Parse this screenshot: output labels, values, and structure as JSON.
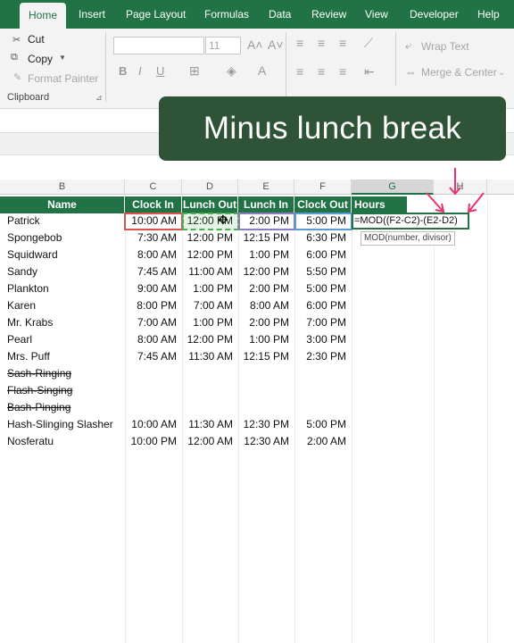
{
  "ribbon_tabs": [
    "Home",
    "Insert",
    "Page Layout",
    "Formulas",
    "Data",
    "Review",
    "View",
    "Developer",
    "Help"
  ],
  "clipboard": {
    "cut": "Cut",
    "copy": "Copy",
    "format_painter": "Format Painter",
    "group_label": "Clipboard"
  },
  "font": {
    "size": "11",
    "bold": "B",
    "italic": "I",
    "underline": "U"
  },
  "alignment": {
    "wrap_text": "Wrap Text",
    "merge_center": "Merge & Center"
  },
  "banner": {
    "text": "Minus lunch break"
  },
  "column_letters": [
    "B",
    "C",
    "D",
    "E",
    "F",
    "G",
    "H"
  ],
  "headers": [
    "Name",
    "Clock In",
    "Lunch Out",
    "Lunch In",
    "Clock Out",
    "Hours Worked"
  ],
  "rows": [
    {
      "name": "Patrick",
      "clock_in": "10:00 AM",
      "lunch_out": "12:00 PM",
      "lunch_in": "2:00 PM",
      "clock_out": "5:00 PM",
      "strike": false
    },
    {
      "name": "Spongebob",
      "clock_in": "7:30 AM",
      "lunch_out": "12:00 PM",
      "lunch_in": "12:15 PM",
      "clock_out": "6:30 PM",
      "strike": false
    },
    {
      "name": "Squidward",
      "clock_in": "8:00 AM",
      "lunch_out": "12:00 PM",
      "lunch_in": "1:00 PM",
      "clock_out": "6:00 PM",
      "strike": false
    },
    {
      "name": "Sandy",
      "clock_in": "7:45 AM",
      "lunch_out": "11:00 AM",
      "lunch_in": "12:00 PM",
      "clock_out": "5:50 PM",
      "strike": false
    },
    {
      "name": "Plankton",
      "clock_in": "9:00 AM",
      "lunch_out": "1:00 PM",
      "lunch_in": "2:00 PM",
      "clock_out": "5:00 PM",
      "strike": false
    },
    {
      "name": "Karen",
      "clock_in": "8:00 PM",
      "lunch_out": "7:00 AM",
      "lunch_in": "8:00 AM",
      "clock_out": "6:00 PM",
      "strike": false
    },
    {
      "name": "Mr. Krabs",
      "clock_in": "7:00 AM",
      "lunch_out": "1:00 PM",
      "lunch_in": "2:00 PM",
      "clock_out": "7:00 PM",
      "strike": false
    },
    {
      "name": "Pearl",
      "clock_in": "8:00 AM",
      "lunch_out": "12:00 PM",
      "lunch_in": "1:00 PM",
      "clock_out": "3:00 PM",
      "strike": false
    },
    {
      "name": "Mrs. Puff",
      "clock_in": "7:45 AM",
      "lunch_out": "11:30 AM",
      "lunch_in": "12:15 PM",
      "clock_out": "2:30 PM",
      "strike": false
    },
    {
      "name": "Sash-Ringing",
      "clock_in": "",
      "lunch_out": "",
      "lunch_in": "",
      "clock_out": "",
      "strike": true
    },
    {
      "name": "Flash-Singing",
      "clock_in": "",
      "lunch_out": "",
      "lunch_in": "",
      "clock_out": "",
      "strike": true
    },
    {
      "name": "Bash-Pinging",
      "clock_in": "",
      "lunch_out": "",
      "lunch_in": "",
      "clock_out": "",
      "strike": true
    },
    {
      "name": "Hash-Slinging Slasher",
      "clock_in": "10:00 AM",
      "lunch_out": "11:30 AM",
      "lunch_in": "12:30 PM",
      "clock_out": "5:00 PM",
      "strike": false
    },
    {
      "name": "Nosferatu",
      "clock_in": "10:00 PM",
      "lunch_out": "12:00 AM",
      "lunch_in": "12:30 AM",
      "clock_out": "2:00 AM",
      "strike": false
    }
  ],
  "formula": {
    "text": "=MOD((F2-C2)-(E2-D2)",
    "tooltip": "MOD(number, divisor)"
  },
  "colors": {
    "accent": "#217346",
    "banner": "#2f5336",
    "ref_red": "#d9534f",
    "ref_green": "#4caf50",
    "ref_purple": "#8e7cc3",
    "arrow_pink": "#e8336d"
  }
}
